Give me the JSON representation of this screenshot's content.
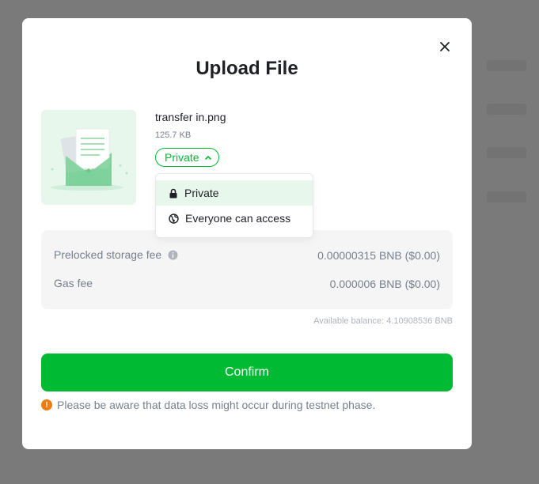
{
  "modal": {
    "title": "Upload File",
    "close_icon": "close-icon"
  },
  "file": {
    "name": "transfer in.png",
    "size": "125.7 KB",
    "thumbnail_icon": "document-envelope-icon"
  },
  "access": {
    "current": "Private",
    "options": [
      {
        "label": "Private",
        "icon": "lock-icon",
        "selected": true
      },
      {
        "label": "Everyone can access",
        "icon": "globe-icon",
        "selected": false
      }
    ]
  },
  "fees": {
    "prelocked_label": "Prelocked storage fee",
    "prelocked_value": "0.00000315 BNB ($0.00)",
    "gas_label": "Gas fee",
    "gas_value": "0.000006 BNB ($0.00)",
    "info_icon": "info-icon"
  },
  "balance": "Available balance: 4.10908536 BNB",
  "confirm_label": "Confirm",
  "warning": {
    "icon": "warning-icon",
    "text": "Please be aware that data loss might occur during testnet phase."
  },
  "colors": {
    "accent": "#00BA34",
    "accent_light": "#E7F7EC",
    "warning": "#EE7C11",
    "overlay": "#7A7A7A"
  }
}
